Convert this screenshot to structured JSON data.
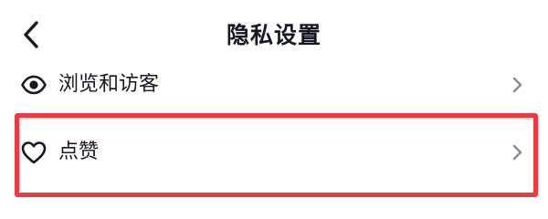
{
  "header": {
    "title": "隐私设置",
    "back_icon": "chevron-left-icon"
  },
  "settings_list": {
    "items": [
      {
        "label": "浏览和访客",
        "icon": "eye-icon",
        "trailing_icon": "chevron-right-icon"
      },
      {
        "label": "点赞",
        "icon": "heart-icon",
        "trailing_icon": "chevron-right-icon"
      }
    ]
  },
  "colors": {
    "text_primary": "#161823",
    "chevron": "#8a8b91",
    "highlight": "#ee3a3f",
    "background": "#ffffff"
  }
}
